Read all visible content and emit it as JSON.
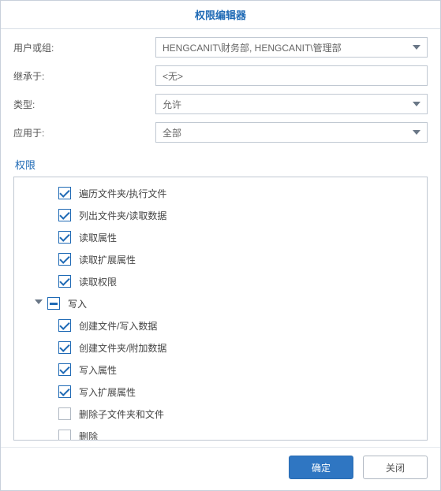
{
  "title": "权限编辑器",
  "form": {
    "user_label": "用户或组:",
    "user_value": "HENGCANIT\\财务部, HENGCANIT\\管理部",
    "inherit_label": "继承于:",
    "inherit_value": "<无>",
    "type_label": "类型:",
    "type_value": "允许",
    "apply_label": "应用于:",
    "apply_value": "全部"
  },
  "permissions_label": "权限",
  "tree": {
    "items": [
      {
        "kind": "leaf",
        "checked": true,
        "label": "遍历文件夹/执行文件"
      },
      {
        "kind": "leaf",
        "checked": true,
        "label": "列出文件夹/读取数据"
      },
      {
        "kind": "leaf",
        "checked": true,
        "label": "读取属性"
      },
      {
        "kind": "leaf",
        "checked": true,
        "label": "读取扩展属性"
      },
      {
        "kind": "leaf",
        "checked": true,
        "label": "读取权限"
      },
      {
        "kind": "group",
        "state": "mixed",
        "label": "写入"
      },
      {
        "kind": "leaf",
        "checked": true,
        "label": "创建文件/写入数据"
      },
      {
        "kind": "leaf",
        "checked": true,
        "label": "创建文件夹/附加数据"
      },
      {
        "kind": "leaf",
        "checked": true,
        "label": "写入属性"
      },
      {
        "kind": "leaf",
        "checked": true,
        "label": "写入扩展属性"
      },
      {
        "kind": "leaf",
        "checked": false,
        "label": "删除子文件夹和文件"
      },
      {
        "kind": "leaf",
        "checked": false,
        "label": "删除"
      }
    ]
  },
  "buttons": {
    "ok": "确定",
    "close": "关闭"
  }
}
